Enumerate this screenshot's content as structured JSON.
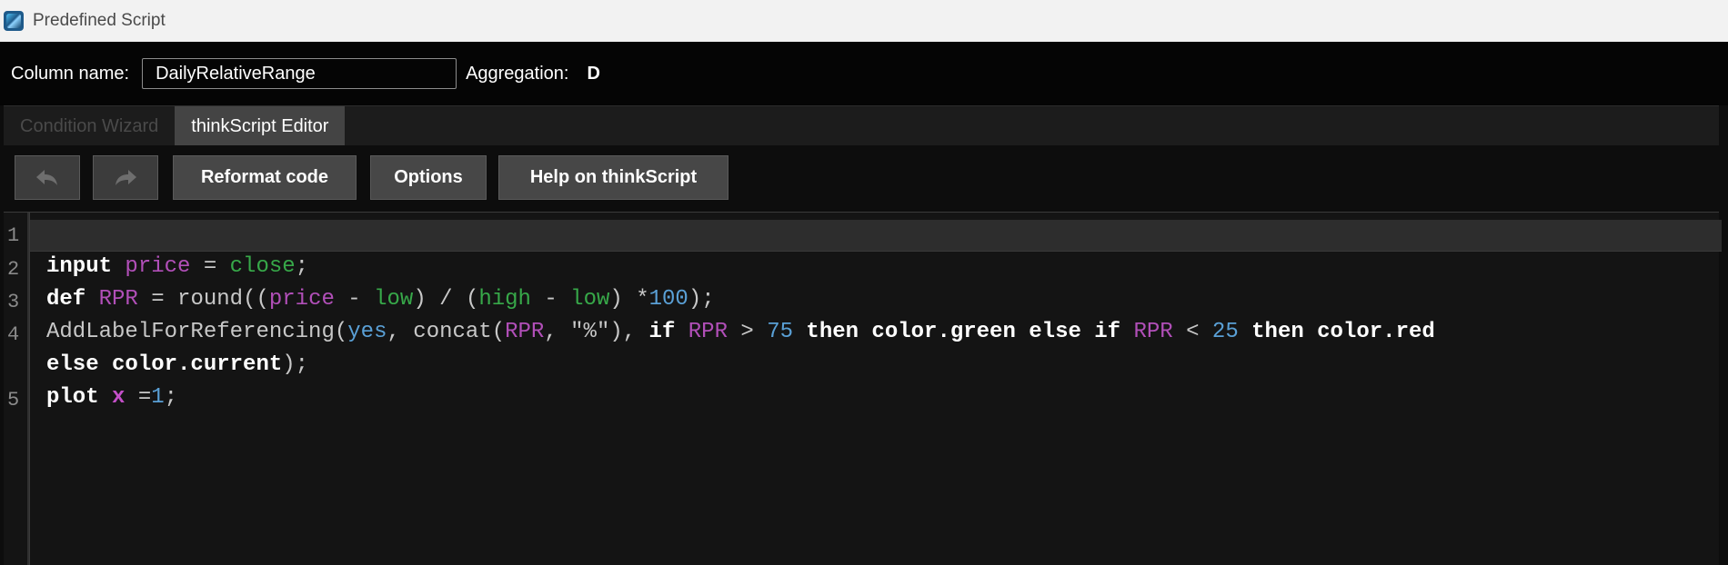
{
  "window": {
    "title": "Predefined Script",
    "icon": "thinkorswim-app-icon"
  },
  "column": {
    "label": "Column name:",
    "value": "DailyRelativeRange"
  },
  "aggregation": {
    "label": "Aggregation:",
    "value": "D"
  },
  "tabs": [
    {
      "label": "Condition Wizard",
      "active": false
    },
    {
      "label": "thinkScript Editor",
      "active": true
    }
  ],
  "toolbar": {
    "undo_icon": "undo-arrow-icon",
    "redo_icon": "redo-arrow-icon",
    "reformat_label": "Reformat code",
    "options_label": "Options",
    "help_label": "Help on thinkScript"
  },
  "editor": {
    "line_numbers": [
      "1",
      "2",
      "3",
      "4",
      "5"
    ],
    "lines": [
      [],
      [
        [
          "kw",
          "input"
        ],
        [
          "op",
          " "
        ],
        [
          "var",
          "price"
        ],
        [
          "op",
          " = "
        ],
        [
          "grn",
          "close"
        ],
        [
          "op",
          ";"
        ]
      ],
      [
        [
          "kw",
          "def"
        ],
        [
          "op",
          " "
        ],
        [
          "var",
          "RPR"
        ],
        [
          "op",
          " = round(("
        ],
        [
          "var",
          "price"
        ],
        [
          "op",
          " - "
        ],
        [
          "grn",
          "low"
        ],
        [
          "op",
          ") / ("
        ],
        [
          "grn",
          "high"
        ],
        [
          "op",
          " - "
        ],
        [
          "grn",
          "low"
        ],
        [
          "op",
          ") *"
        ],
        [
          "blu",
          "100"
        ],
        [
          "op",
          ");"
        ]
      ],
      [
        [
          "op",
          "AddLabelForReferencing("
        ],
        [
          "blu",
          "yes"
        ],
        [
          "op",
          ", concat("
        ],
        [
          "var",
          "RPR"
        ],
        [
          "op",
          ", \"%\"), "
        ],
        [
          "kw",
          "if"
        ],
        [
          "op",
          " "
        ],
        [
          "var",
          "RPR"
        ],
        [
          "op",
          " > "
        ],
        [
          "blu",
          "75"
        ],
        [
          "op",
          " "
        ],
        [
          "kw",
          "then color.green else if"
        ],
        [
          "op",
          " "
        ],
        [
          "var",
          "RPR"
        ],
        [
          "op",
          " < "
        ],
        [
          "blu",
          "25"
        ],
        [
          "op",
          " "
        ],
        [
          "kw",
          "then color.red"
        ]
      ],
      [
        [
          "kw",
          "else color.current"
        ],
        [
          "op",
          ");"
        ]
      ],
      [
        [
          "kw",
          "plot"
        ],
        [
          "op",
          " "
        ],
        [
          "vbold",
          "x"
        ],
        [
          "op",
          " ="
        ],
        [
          "blu",
          "1"
        ],
        [
          "op",
          ";"
        ]
      ]
    ]
  },
  "colors": {
    "background": "#0d0d0d",
    "keyword": "#ffffff",
    "variable": "#b14fb8",
    "builtin": "#37a849",
    "number": "#5aa0d6"
  }
}
